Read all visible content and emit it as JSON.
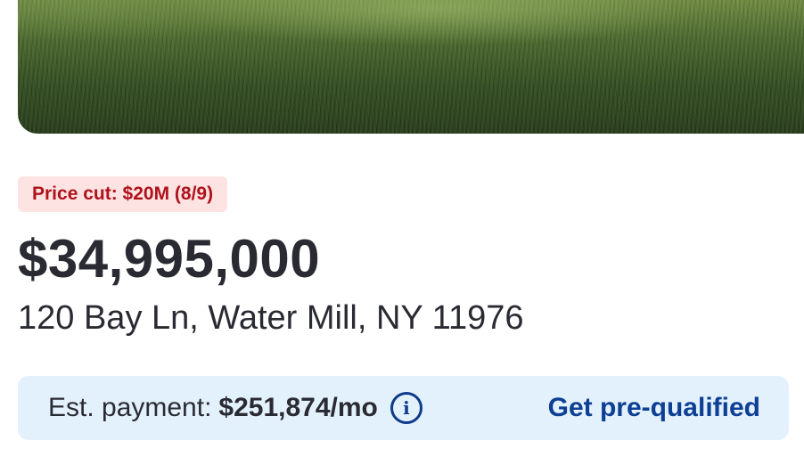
{
  "listing": {
    "price_cut_badge": "Price cut: $20M (8/9)",
    "price": "$34,995,000",
    "address": "120 Bay Ln, Water Mill, NY 11976"
  },
  "payment": {
    "label": "Est. payment:",
    "amount": "$251,874/mo",
    "info_icon_glyph": "i",
    "info_icon": "info-circle-icon",
    "prequalify_label": "Get pre-qualified"
  },
  "colors": {
    "badge_text": "#b0111b",
    "badge_bg": "#fde3e2",
    "payment_bg": "#e3f1fc",
    "link_blue": "#0d3f94"
  }
}
